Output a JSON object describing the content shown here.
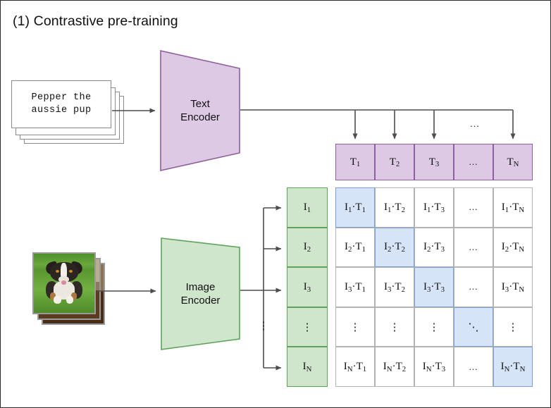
{
  "title": "(1) Contrastive pre-training",
  "text_card": {
    "line1": "Pepper the",
    "line2": "aussie pup"
  },
  "encoders": {
    "text": "Text\nEncoder",
    "image": "Image\nEncoder"
  },
  "ellipsis": {
    "horizontal": "...",
    "vertical": "⋮",
    "diagonal": "⋱"
  },
  "text_embeddings": [
    {
      "base": "T",
      "sub": "1",
      "is_ellipsis": false
    },
    {
      "base": "T",
      "sub": "2",
      "is_ellipsis": false
    },
    {
      "base": "T",
      "sub": "3",
      "is_ellipsis": false
    },
    {
      "base": "...",
      "sub": "",
      "is_ellipsis": true
    },
    {
      "base": "T",
      "sub": "N",
      "is_ellipsis": false
    }
  ],
  "image_embeddings": [
    {
      "base": "I",
      "sub": "1",
      "is_ellipsis": false
    },
    {
      "base": "I",
      "sub": "2",
      "is_ellipsis": false
    },
    {
      "base": "I",
      "sub": "3",
      "is_ellipsis": false
    },
    {
      "base": "⋮",
      "sub": "",
      "is_ellipsis": true
    },
    {
      "base": "I",
      "sub": "N",
      "is_ellipsis": false
    }
  ],
  "similarity_matrix": {
    "rows": [
      [
        "I₁·T₁",
        "I₁·T₂",
        "I₁·T₃",
        "...",
        "I₁·Tₙ"
      ],
      [
        "I₂·T₁",
        "I₂·T₂",
        "I₂·T₃",
        "...",
        "I₂·Tₙ"
      ],
      [
        "I₃·T₁",
        "I₃·T₂",
        "I₃·T₃",
        "...",
        "I₃·Tₙ"
      ],
      [
        "⋮",
        "⋮",
        "⋮",
        "⋱",
        "⋮"
      ],
      [
        "Iₙ·T₁",
        "Iₙ·T₂",
        "Iₙ·T₃",
        "...",
        "Iₙ·Tₙ"
      ]
    ],
    "cells": [
      [
        {
          "i": "1",
          "t": "1",
          "plain": ""
        },
        {
          "i": "1",
          "t": "2",
          "plain": ""
        },
        {
          "i": "1",
          "t": "3",
          "plain": ""
        },
        {
          "i": "",
          "t": "",
          "plain": "..."
        },
        {
          "i": "1",
          "t": "N",
          "plain": ""
        }
      ],
      [
        {
          "i": "2",
          "t": "1",
          "plain": ""
        },
        {
          "i": "2",
          "t": "2",
          "plain": ""
        },
        {
          "i": "2",
          "t": "3",
          "plain": ""
        },
        {
          "i": "",
          "t": "",
          "plain": "..."
        },
        {
          "i": "2",
          "t": "N",
          "plain": ""
        }
      ],
      [
        {
          "i": "3",
          "t": "1",
          "plain": ""
        },
        {
          "i": "3",
          "t": "2",
          "plain": ""
        },
        {
          "i": "3",
          "t": "3",
          "plain": ""
        },
        {
          "i": "",
          "t": "",
          "plain": "..."
        },
        {
          "i": "3",
          "t": "N",
          "plain": ""
        }
      ],
      [
        {
          "i": "",
          "t": "",
          "plain": "⋮"
        },
        {
          "i": "",
          "t": "",
          "plain": "⋮"
        },
        {
          "i": "",
          "t": "",
          "plain": "⋮"
        },
        {
          "i": "",
          "t": "",
          "plain": "⋱"
        },
        {
          "i": "",
          "t": "",
          "plain": "⋮"
        }
      ],
      [
        {
          "i": "N",
          "t": "1",
          "plain": ""
        },
        {
          "i": "N",
          "t": "2",
          "plain": ""
        },
        {
          "i": "N",
          "t": "3",
          "plain": ""
        },
        {
          "i": "",
          "t": "",
          "plain": "..."
        },
        {
          "i": "N",
          "t": "N",
          "plain": ""
        }
      ]
    ],
    "highlighted_diagonal": [
      [
        0,
        0
      ],
      [
        1,
        1
      ],
      [
        2,
        2
      ],
      [
        3,
        3
      ],
      [
        4,
        4
      ]
    ]
  },
  "colors": {
    "text_encoder_fill": "#ddc9e4",
    "text_encoder_stroke": "#8e5f9e",
    "image_encoder_fill": "#cfe6cc",
    "image_encoder_stroke": "#5da35a",
    "matrix_highlight_fill": "#d6e4f7",
    "matrix_highlight_stroke": "#7b9fd4",
    "matrix_cell_stroke": "#b3b3b3",
    "wire": "#4d4d4d",
    "page_border": "#2b2b2b"
  }
}
